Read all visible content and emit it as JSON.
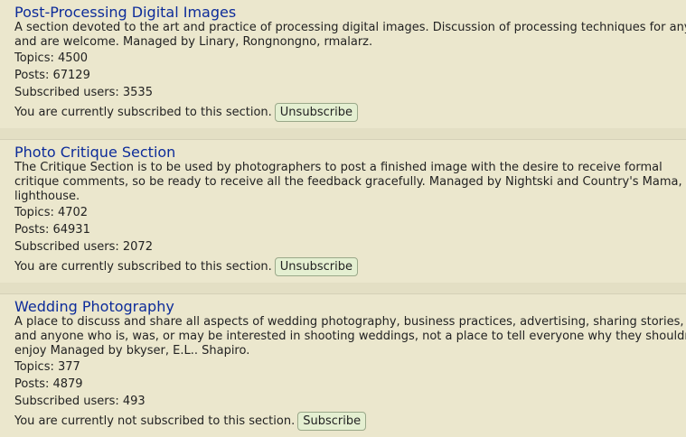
{
  "sections": [
    {
      "title": "Post-Processing Digital Images",
      "description": "A section devoted to the art and practice of processing digital images. Discussion of processing techniques for any and are welcome. Managed by Linary, Rongnongno, rmalarz.",
      "topics": "Topics: 4500",
      "posts": "Posts: 67129",
      "subscribers": "Subscribed users: 3535",
      "status_text": "You are currently subscribed to this section.",
      "button_label": "Unsubscribe"
    },
    {
      "title": "Photo Critique Section",
      "description": "The Critique Section is to be used by photographers to post a finished image with the desire to receive formal critique comments, so be ready to receive all the feedback gracefully. Managed by Nightski and Country's Mama, lighthouse.",
      "topics": "Topics: 4702",
      "posts": "Posts: 64931",
      "subscribers": "Subscribed users: 2072",
      "status_text": "You are currently subscribed to this section.",
      "button_label": "Unsubscribe"
    },
    {
      "title": "Wedding Photography",
      "description": "A place to discuss and share all aspects of wedding photography, business practices, advertising, sharing stories, and anyone who is, was, or may be interested in shooting weddings, not a place to tell everyone why they shouldn't enjoy Managed by bkyser, E.L.. Shapiro.",
      "topics": "Topics: 377",
      "posts": "Posts: 4879",
      "subscribers": "Subscribed users: 493",
      "status_text": "You are currently not subscribed to this section.",
      "button_label": "Subscribe"
    }
  ]
}
